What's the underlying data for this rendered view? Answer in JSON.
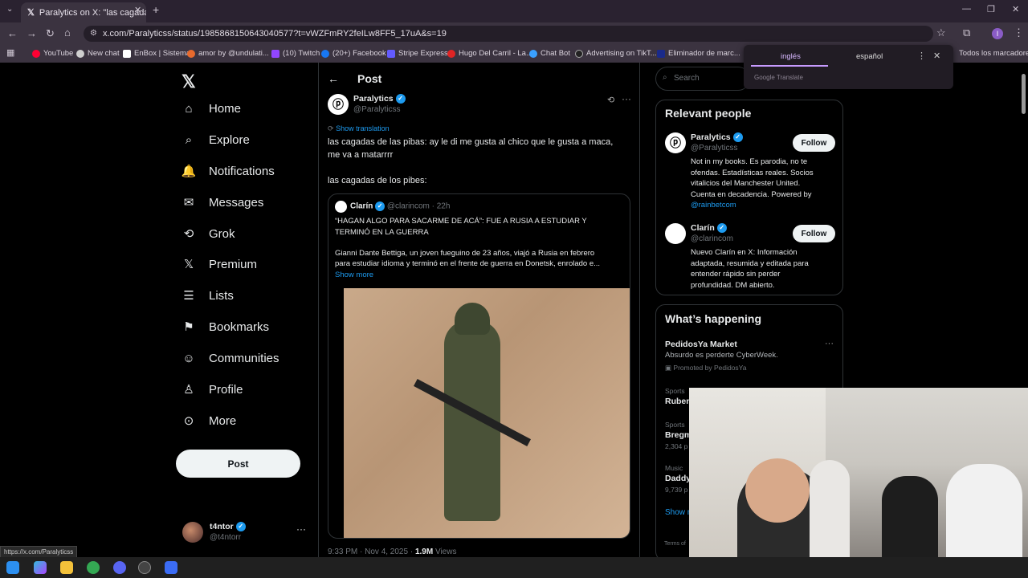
{
  "browser": {
    "tab_title": "Paralytics on X: \"las cagadas de",
    "url": "x.com/Paralyticss/status/1985868150643040577?t=vWZFmRY2feILw8FF5_17uA&s=19",
    "bookmarks": [
      "YouTube",
      "New chat",
      "EnBox | Sistema",
      "amor by @undulati...",
      "(10) Twitch",
      "(20+) Facebook",
      "Stripe Express",
      "Hugo Del Carril - La...",
      "Chat Bot",
      "Advertising on TikT...",
      "Eliminador de marc..."
    ],
    "all_bookmarks": "Todos los marcadores",
    "status_url": "https://x.com/Paralyticss"
  },
  "translate_popup": {
    "lang_from": "inglés",
    "lang_to": "español",
    "brand": "Google Translate"
  },
  "sidebar": {
    "items": [
      {
        "label": "Home",
        "icon": "home-icon"
      },
      {
        "label": "Explore",
        "icon": "search-icon"
      },
      {
        "label": "Notifications",
        "icon": "bell-icon"
      },
      {
        "label": "Messages",
        "icon": "mail-icon"
      },
      {
        "label": "Grok",
        "icon": "grok-icon"
      },
      {
        "label": "Premium",
        "icon": "x-logo-icon"
      },
      {
        "label": "Lists",
        "icon": "list-icon"
      },
      {
        "label": "Bookmarks",
        "icon": "bookmark-icon"
      },
      {
        "label": "Communities",
        "icon": "people-icon"
      },
      {
        "label": "Profile",
        "icon": "person-icon"
      },
      {
        "label": "More",
        "icon": "more-circle-icon"
      }
    ],
    "post_button": "Post",
    "account": {
      "name": "t4ntor",
      "handle": "@t4ntorr"
    }
  },
  "post": {
    "header": "Post",
    "author_name": "Paralytics",
    "author_handle": "@Paralyticss",
    "show_translation": "Show translation",
    "text_line1": "las cagadas de las pibas: ay le di me gusta al chico que le gusta a maca,",
    "text_line2": "me va a matarrrr",
    "text_line3": "las cagadas de los pibes:",
    "quote": {
      "name": "Clarín",
      "handle": "@clarincom",
      "time": "· 22h",
      "headline1": "“HAGAN ALGO PARA SACARME DE ACÁ”: FUE A RUSIA A ESTUDIAR Y",
      "headline2": "TERMINÓ EN LA GUERRA",
      "body1": "Gianni Dante Bettiga, un joven fueguino de 23 años, viajó a Rusia en febrero",
      "body2": "para estudiar idioma y terminó en el frente de guerra en Donetsk, enrolado e...",
      "show_more": "Show more"
    },
    "timestamp": "9:33 PM · Nov 4, 2025 ·",
    "views_count": "1.9M",
    "views_label": "Views"
  },
  "right": {
    "search_placeholder": "Search",
    "relevant_title": "Relevant people",
    "people": [
      {
        "name": "Paralytics",
        "handle": "@Paralyticss",
        "follow": "Follow",
        "bio": [
          "Not in my books. Es parodia, no te",
          "ofendas. Estadísticas reales. Socios",
          "vitalicios del Manchester United.",
          "Cuenta en decadencia. Powered by"
        ],
        "link": "@rainbetcom"
      },
      {
        "name": "Clarín",
        "handle": "@clarincom",
        "follow": "Follow",
        "bio": [
          "Nuevo Clarín en X: Información",
          "adaptada, resumida y editada para",
          "entender rápido sin perder",
          "profundidad. DM abierto."
        ],
        "link": ""
      }
    ],
    "happening_title": "What’s happening",
    "trends": [
      {
        "top": "",
        "title": "PedidosYa Market",
        "sub": "Absurdo es perderte CyberWeek.",
        "promo": "Promoted by PedidosYa"
      },
      {
        "top": "Sports",
        "title": "Ruben",
        "sub": ""
      },
      {
        "top": "Sports",
        "title": "Bregm",
        "sub": "2,304 p"
      },
      {
        "top": "Music",
        "title": "Daddy",
        "sub": "9,739 p"
      }
    ],
    "show_more": "Show m",
    "terms": "Terms of"
  },
  "colors": {
    "accent": "#1d9bf0",
    "bg": "#000000",
    "border": "#2f3336",
    "chrome": "#3b3340"
  }
}
